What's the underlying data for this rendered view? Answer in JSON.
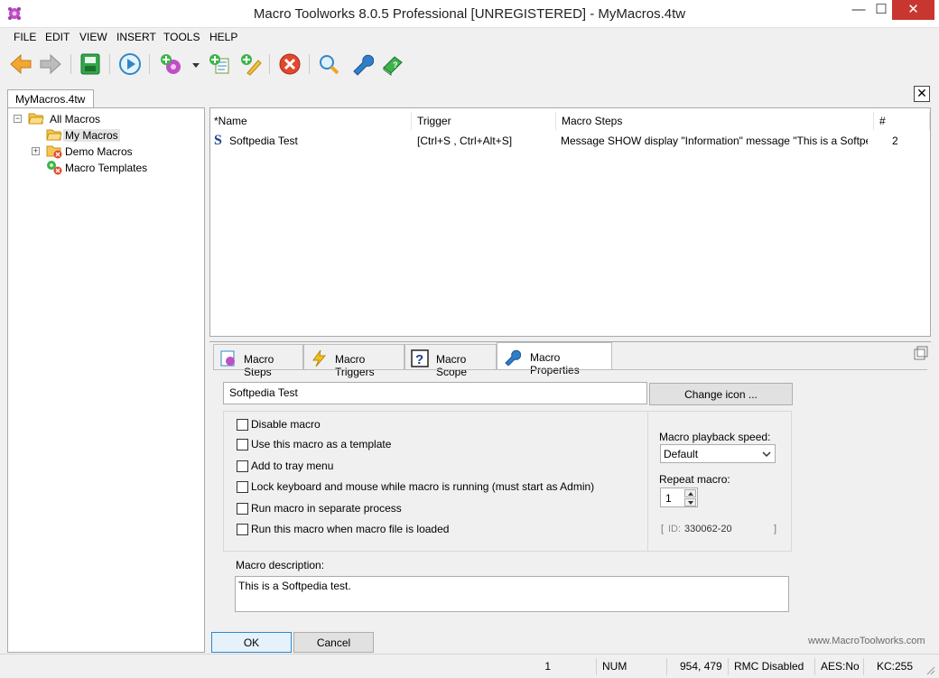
{
  "window": {
    "title": "Macro Toolworks 8.0.5 Professional [UNREGISTERED] - MyMacros.4tw",
    "minimize": "—",
    "maximize": "☐",
    "close": "✕"
  },
  "menu": [
    "FILE",
    "EDIT",
    "VIEW",
    "INSERT",
    "TOOLS",
    "HELP"
  ],
  "document_tab": {
    "label": "MyMacros.4tw",
    "close": "✕"
  },
  "tree": {
    "items": [
      {
        "label": "All Macros",
        "expander": "−"
      },
      {
        "label": "My Macros"
      },
      {
        "label": "Demo Macros",
        "expander": "+"
      },
      {
        "label": "Macro Templates"
      }
    ]
  },
  "macro_list": {
    "columns": [
      "*Name",
      "Trigger",
      "Macro Steps",
      "#"
    ],
    "rows": [
      {
        "name": "Softpedia Test",
        "trigger": "[Ctrl+S , Ctrl+Alt+S]",
        "steps": "Message SHOW display \"Information\" message \"This is a Softpedia t...",
        "count": "2"
      }
    ]
  },
  "tabs": [
    {
      "label": "Macro Steps"
    },
    {
      "label": "Macro Triggers"
    },
    {
      "label": "Macro Scope"
    },
    {
      "label": "Macro Properties"
    }
  ],
  "properties": {
    "macro_name": "Softpedia Test",
    "change_icon_label": "Change icon ...",
    "options": [
      {
        "label": "Disable macro",
        "checked": false
      },
      {
        "label": "Use this macro as a template",
        "checked": false
      },
      {
        "label": "Add to tray menu",
        "checked": false
      },
      {
        "label": "Lock keyboard and mouse while macro is running (must start as Admin)",
        "checked": false
      },
      {
        "label": "Run macro in separate process",
        "checked": false
      },
      {
        "label": "Run this macro when macro file is loaded",
        "checked": false
      }
    ],
    "playback_speed_label": "Macro playback speed:",
    "playback_speed_value": "Default",
    "repeat_label": "Repeat macro:",
    "repeat_value": "1",
    "id_open": "[",
    "id_label": "ID:",
    "id_value": "330062-20",
    "id_close": "]",
    "description_label": "Macro description:",
    "description_value": "This is a Softpedia test.",
    "ok_label": "OK",
    "cancel_label": "Cancel",
    "website": "www.MacroToolworks.com"
  },
  "status": {
    "count": "1",
    "num": "NUM",
    "coords": "954, 479",
    "rmc": "RMC Disabled",
    "aes": "AES:No",
    "kc": "KC:255"
  },
  "icons": {
    "app": "gear-app-icon",
    "toolbar": [
      "back-icon",
      "forward-icon",
      "save-icon",
      "play-icon",
      "new-macro-icon",
      "dropdown-arrow-icon",
      "add-macro-icon",
      "add-wizard-icon",
      "delete-icon",
      "search-icon",
      "settings-wrench-icon",
      "help-book-icon"
    ]
  }
}
